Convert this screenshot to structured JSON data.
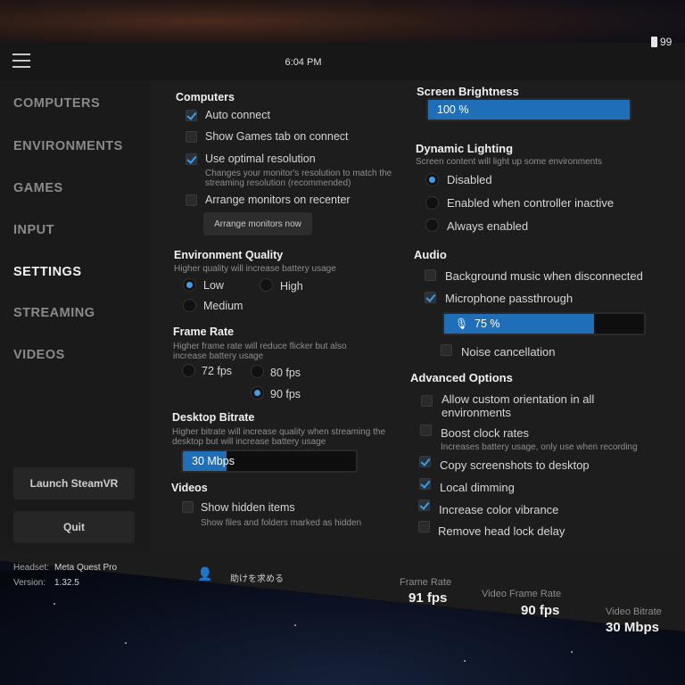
{
  "status": {
    "time": "6:04 PM",
    "battery": "99"
  },
  "sidebar": {
    "items": [
      {
        "label": "COMPUTERS"
      },
      {
        "label": "ENVIRONMENTS"
      },
      {
        "label": "GAMES"
      },
      {
        "label": "INPUT"
      },
      {
        "label": "SETTINGS"
      },
      {
        "label": "STREAMING"
      },
      {
        "label": "VIDEOS"
      }
    ],
    "active": "SETTINGS",
    "launch_label": "Launch SteamVR",
    "quit_label": "Quit"
  },
  "computers": {
    "title": "Computers",
    "auto_connect": {
      "label": "Auto connect",
      "checked": true
    },
    "show_games_tab": {
      "label": "Show Games tab on connect",
      "checked": false
    },
    "optimal_resolution": {
      "label": "Use optimal resolution",
      "checked": true,
      "desc": "Changes your monitor's resolution to match the streaming resolution (recommended)"
    },
    "arrange_monitors": {
      "label": "Arrange monitors on recenter",
      "checked": false
    },
    "arrange_now_label": "Arrange monitors now"
  },
  "environment_quality": {
    "title": "Environment Quality",
    "desc": "Higher quality will increase battery usage",
    "options": [
      "Low",
      "High",
      "Medium"
    ],
    "selected": "Low"
  },
  "frame_rate": {
    "title": "Frame Rate",
    "desc": "Higher frame rate will reduce flicker but also increase battery usage",
    "options": [
      "72 fps",
      "80 fps",
      "90 fps"
    ],
    "selected": "90 fps"
  },
  "desktop_bitrate": {
    "title": "Desktop Bitrate",
    "desc": "Higher bitrate will increase quality when streaming the desktop but will increase battery usage",
    "value": "30 Mbps",
    "level": 0.25
  },
  "videos": {
    "title": "Videos",
    "show_hidden": {
      "label": "Show hidden items",
      "checked": false,
      "desc": "Show files and folders marked as hidden"
    }
  },
  "screen_brightness": {
    "title": "Screen Brightness",
    "value": "100 %",
    "level": 1.0
  },
  "dynamic_lighting": {
    "title": "Dynamic Lighting",
    "desc": "Screen content will light up some environments",
    "options": [
      "Disabled",
      "Enabled when controller inactive",
      "Always enabled"
    ],
    "selected": "Disabled"
  },
  "audio": {
    "title": "Audio",
    "background_music": {
      "label": "Background music when disconnected",
      "checked": false
    },
    "mic_passthrough": {
      "label": "Microphone passthrough",
      "checked": true
    },
    "mic_level": {
      "value": "75 %",
      "level": 0.75
    },
    "noise_cancellation": {
      "label": "Noise cancellation",
      "checked": false
    }
  },
  "advanced": {
    "title": "Advanced Options",
    "custom_orientation": {
      "label": "Allow custom orientation in all environments",
      "checked": false
    },
    "boost_clock": {
      "label": "Boost clock rates",
      "checked": false,
      "desc": "Increases battery usage, only use when recording"
    },
    "copy_screenshots": {
      "label": "Copy screenshots to desktop",
      "checked": true
    },
    "local_dimming": {
      "label": "Local dimming",
      "checked": true
    },
    "color_vibrance": {
      "label": "Increase color vibrance",
      "checked": true
    },
    "remove_head_lock": {
      "label": "Remove head lock delay",
      "checked": false
    }
  },
  "footer": {
    "headset_label": "Headset:",
    "headset_value": "Meta Quest Pro",
    "version_label": "Version:",
    "version_value": "1.32.5",
    "help_label": "助けを求める",
    "frame_rate_label": "Frame Rate",
    "frame_rate_value": "91 fps",
    "video_frame_rate_label": "Video Frame Rate",
    "video_frame_rate_value": "90 fps",
    "video_bitrate_label": "Video Bitrate",
    "video_bitrate_value": "30 Mbps"
  }
}
